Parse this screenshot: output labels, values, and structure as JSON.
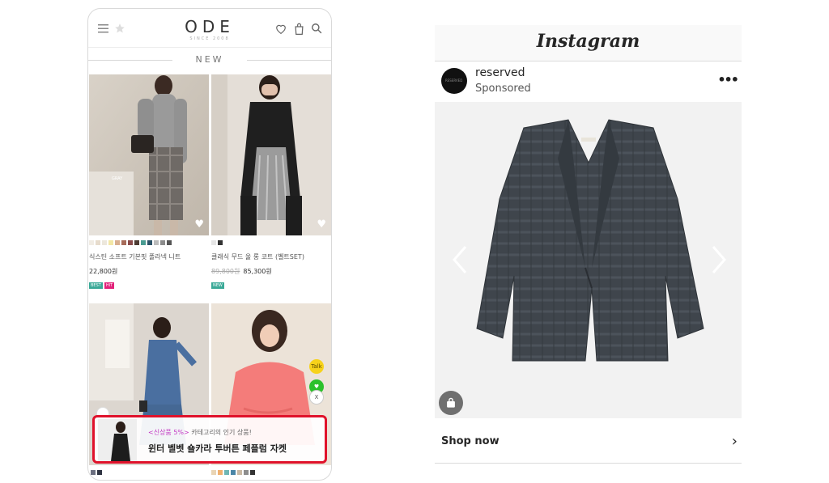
{
  "shop": {
    "logo": "ODE",
    "logo_sub": "SINCE 2008",
    "section_title": "NEW",
    "products": [
      {
        "name": "식스틴 소프트 기본핏 폴라넥 니트",
        "price": "22,800원",
        "old_price": "",
        "img_caption": "GRAY",
        "badges": [
          "BEST",
          "HIT"
        ],
        "swatches": [
          "#f1ece4",
          "#e7dccd",
          "#ece7dc",
          "#f3e7a6",
          "#d8ae8f",
          "#a76c5a",
          "#8a4b4b",
          "#4e3c34",
          "#4a9c92",
          "#2d5267",
          "#bcbcbc",
          "#8c8c8c",
          "#555555"
        ]
      },
      {
        "name": "클래식 무드 울 롱 코트 (벨트SET)",
        "price": "85,300원",
        "old_price": "89,800원",
        "img_caption": "",
        "badges": [
          "NEW"
        ],
        "swatches": [
          "#e6e6e6",
          "#333333"
        ]
      }
    ],
    "bottom_swatches_left": [
      "#6b6f80",
      "#2f3442"
    ],
    "bottom_swatches_right": [
      "#e9d4b4",
      "#f0b06e",
      "#6fb6b4",
      "#4b86a7",
      "#c9b9a4",
      "#8d8d8d",
      "#333333"
    ],
    "side_buttons": [
      "Talk",
      "♥",
      "X"
    ],
    "banner": {
      "highlight": "<신상품 5%>",
      "line1": " 카테고리의 인기 상품!",
      "line2": "윈터 벨벳 숄카라 투버튼 페플럼 자켓"
    }
  },
  "instagram": {
    "logo": "Instagram",
    "username": "reserved",
    "sponsored": "Sponsored",
    "avatar_text": "RESERVED",
    "cta": "Shop now",
    "icons": [
      "more-options-icon",
      "prev-arrow-icon",
      "next-arrow-icon",
      "shopping-bag-icon",
      "chevron-right-icon"
    ]
  },
  "colors": {
    "banner_border": "#e0122b",
    "banner_highlight": "#c338c3",
    "badge_best": "#3aa997",
    "badge_hit": "#e2227a",
    "badge_new": "#3aa997"
  }
}
